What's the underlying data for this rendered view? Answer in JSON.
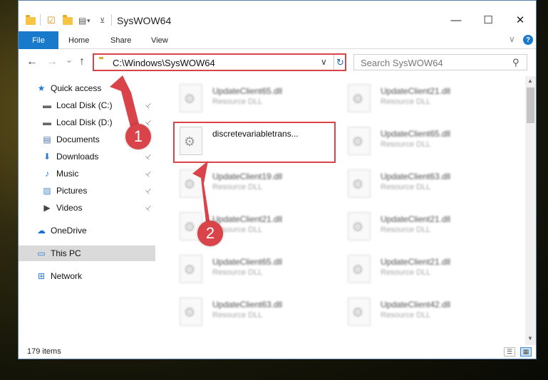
{
  "window": {
    "title": "SysWOW64",
    "controls": {
      "minimize": "—",
      "maximize": "☐",
      "close": "✕"
    }
  },
  "ribbon": {
    "tabs": [
      "File",
      "Home",
      "Share",
      "View"
    ],
    "help": "?",
    "collapse": "∨"
  },
  "nav": {
    "back": "←",
    "forward": "→",
    "recent": "⌄",
    "up": "↑",
    "address": "C:\\Windows\\SysWOW64",
    "address_dropdown": "∨",
    "refresh": "↻",
    "search_placeholder": "Search SysWOW64",
    "search_icon": "⚲"
  },
  "sidebar": {
    "items": [
      {
        "label": "Quick access",
        "icon": "star-icon",
        "glyph": "★",
        "color": "#2a7ad4",
        "pinned": false
      },
      {
        "label": "Local Disk (C:)",
        "icon": "drive-icon",
        "glyph": "▬",
        "color": "#666666",
        "pinned": true
      },
      {
        "label": "Local Disk (D:)",
        "icon": "drive-icon",
        "glyph": "▬",
        "color": "#666666",
        "pinned": true
      },
      {
        "label": "Documents",
        "icon": "documents-icon",
        "glyph": "▤",
        "color": "#4a6fa5",
        "pinned": true
      },
      {
        "label": "Downloads",
        "icon": "downloads-icon",
        "glyph": "⬇",
        "color": "#2a7ad4",
        "pinned": true
      },
      {
        "label": "Music",
        "icon": "music-icon",
        "glyph": "♪",
        "color": "#2a7ad4",
        "pinned": true
      },
      {
        "label": "Pictures",
        "icon": "pictures-icon",
        "glyph": "▨",
        "color": "#4a8ad4",
        "pinned": true
      },
      {
        "label": "Videos",
        "icon": "videos-icon",
        "glyph": "▶",
        "color": "#444444",
        "pinned": true
      },
      {
        "label": "OneDrive",
        "icon": "cloud-icon",
        "glyph": "☁",
        "color": "#1a6fd0",
        "pinned": false
      },
      {
        "label": "This PC",
        "icon": "computer-icon",
        "glyph": "▭",
        "color": "#2a7ad4",
        "pinned": false
      },
      {
        "label": "Network",
        "icon": "network-icon",
        "glyph": "⊞",
        "color": "#2a7ad4",
        "pinned": false
      }
    ],
    "pin_glyph": "📌"
  },
  "files": [
    {
      "name": "UpdateClient65.dll",
      "type": "Resource DLL"
    },
    {
      "name": "UpdateClient21.dll",
      "type": "Resource DLL"
    },
    {
      "name": "discretevariabletrans...",
      "type": ""
    },
    {
      "name": "UpdateClient65.dll",
      "type": "Resource DLL"
    },
    {
      "name": "UpdateClient19.dll",
      "type": "Resource DLL"
    },
    {
      "name": "UpdateClient63.dll",
      "type": "Resource DLL"
    },
    {
      "name": "UpdateClient21.dll",
      "type": "Resource DLL"
    },
    {
      "name": "UpdateClient21.dll",
      "type": "Resource DLL"
    },
    {
      "name": "UpdateClient65.dll",
      "type": "Resource DLL"
    },
    {
      "name": "UpdateClient21.dll",
      "type": "Resource DLL"
    },
    {
      "name": "UpdateClient63.dll",
      "type": "Resource DLL"
    },
    {
      "name": "UpdateClient42.dll",
      "type": "Resource DLL"
    }
  ],
  "status": {
    "count": "179 items",
    "details_view": "☰",
    "tiles_view": "▦"
  },
  "annotations": {
    "step1": "1",
    "step2": "2",
    "color": "#d9434a"
  },
  "colors": {
    "accent": "#1979ca",
    "highlight": "#d9434a"
  }
}
